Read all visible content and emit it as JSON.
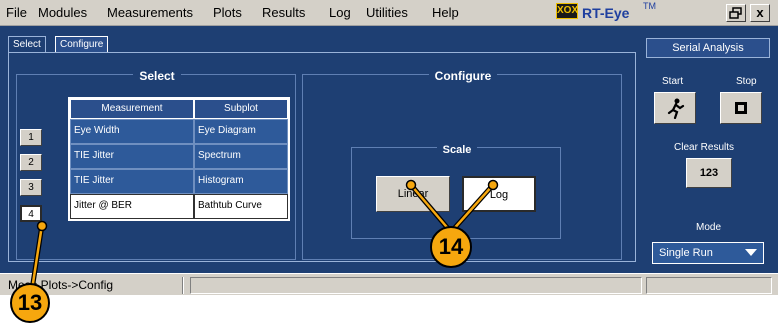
{
  "menu": {
    "items": [
      "File",
      "Modules",
      "Measurements",
      "Plots",
      "Results",
      "Log",
      "Utilities",
      "Help"
    ],
    "logo_box": "XOX",
    "logo_text": "RT-Eye",
    "logo_tm": "TM",
    "close_glyph": "x"
  },
  "tabs": {
    "select": "Select",
    "configure": "Configure"
  },
  "select_group": {
    "title": "Select",
    "table_headers": [
      "Measurement",
      "Subplot"
    ],
    "rows": [
      {
        "num": "1",
        "measurement": "Eye Width",
        "subplot": "Eye Diagram"
      },
      {
        "num": "2",
        "measurement": "TIE Jitter",
        "subplot": "Spectrum"
      },
      {
        "num": "3",
        "measurement": "TIE Jitter",
        "subplot": "Histogram"
      },
      {
        "num": "4",
        "measurement": "Jitter @ BER",
        "subplot": "Bathtub Curve"
      }
    ],
    "selected_row": 4
  },
  "configure_group": {
    "title": "Configure",
    "scale_title": "Scale",
    "linear_label": "Linear",
    "log_label": "Log",
    "selected_scale": "Log"
  },
  "side_panel": {
    "title": "Serial Analysis",
    "start_label": "Start",
    "stop_label": "Stop",
    "clear_label": "Clear Results",
    "clear_icon_text": "123",
    "mode_label": "Mode",
    "mode_value": "Single Run"
  },
  "status": {
    "text": "Meas Plots->Config"
  },
  "callouts": {
    "c13": "13",
    "c14": "14"
  },
  "colors": {
    "panel": "#1e3f73",
    "callout": "#f6a70e"
  }
}
